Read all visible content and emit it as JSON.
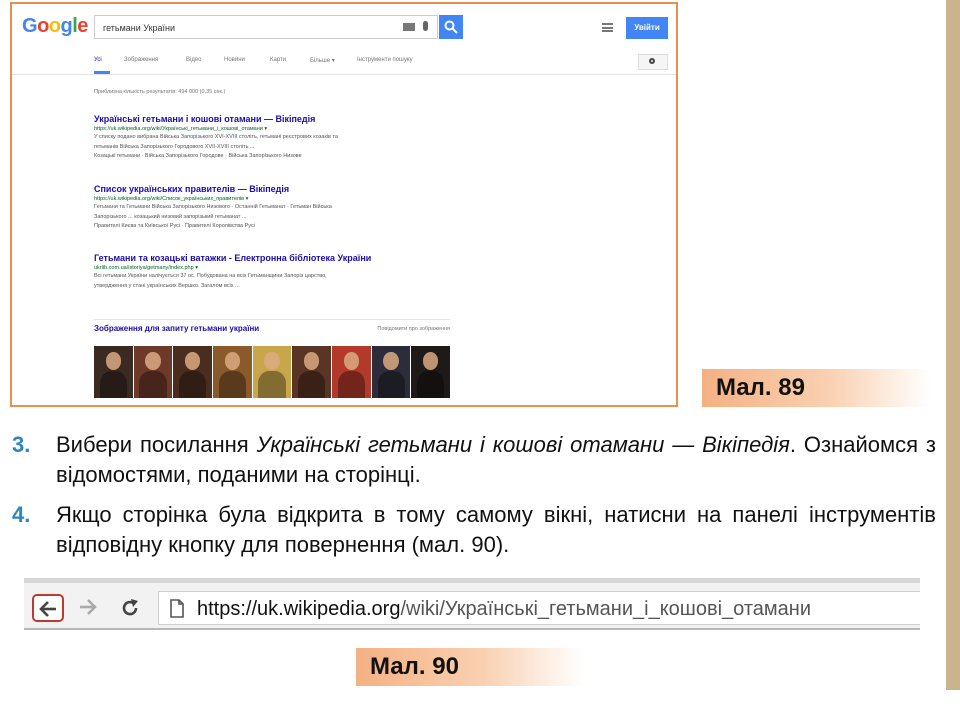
{
  "figure89": {
    "google": {
      "logo": [
        "G",
        "o",
        "o",
        "g",
        "l",
        "e"
      ],
      "query": "гетьмани України",
      "signin_label": "Увійти",
      "tabs": [
        {
          "label": "Усі",
          "active": true
        },
        {
          "label": "Зображення",
          "active": false
        },
        {
          "label": "Відео",
          "active": false
        },
        {
          "label": "Новини",
          "active": false
        },
        {
          "label": "Карти",
          "active": false
        },
        {
          "label": "Більше ▾",
          "active": false
        },
        {
          "label": "Інструменти пошуку",
          "active": false
        }
      ],
      "stats": "Приблизна кількість результатів: 494 000 (0,35 сек.)",
      "results": [
        {
          "title": "Українські гетьмани і кошові отамани — Вікіпедія",
          "url": "https://uk.wikipedia.org/wiki/Українські_гетьмани_і_кошові_отамани ▾",
          "snippets": [
            "У списку подано вибрана Війська Запорізького XVI-XVIII століть, гетьмані реєстрових козаків та",
            "гетьманів Війська Запорізького Городового XVII-XVIII століть ...",
            "Козацькі гетьмани · Війська Запорізького Городове · Війська Запорізького Низове"
          ]
        },
        {
          "title": "Список українських правителів — Вікіпедія",
          "url": "https://uk.wikipedia.org/wiki/Список_українських_правителів ▾",
          "snippets": [
            "Гетьмани та Гетьмани Війська Запорізького Низового · Останній Гетьманат · Гетьман Війська",
            "Запорізького ... козацький низовий запорізький гетьманат ...",
            "Правителі Києва та Київської Русі · Правителі Королівства Русі"
          ]
        },
        {
          "title": "Гетьмани та козацькі ватажки - Електронна бібліотека України",
          "url": "ukrlib.com.ua/istoriya/getmany/index.php ▾",
          "snippets": [
            "Всі гетьмани України налічується 37 ос. Побудована на всіх Гетьманщини Запоріз царство,",
            "утвердження у стані українських Вершко. Загалом всіх ..."
          ]
        }
      ],
      "images_title": "Зображення для запиту гетьмани україни",
      "images_more": "Повідомити про зображення",
      "thumb_colors": [
        "#3b2a22",
        "#6d3a2a",
        "#4a2d1f",
        "#8a5a2b",
        "#c8a64c",
        "#5a3424",
        "#b33a2a",
        "#2c2c3a",
        "#1e1a18"
      ]
    },
    "caption": "Мал. 89"
  },
  "steps": [
    {
      "number": "3.",
      "parts": [
        {
          "text": "Вибери посилання ",
          "italic": false
        },
        {
          "text": "Українські гетьмани і кошові отамани — Вікіпедія",
          "italic": true
        },
        {
          "text": ". Ознайомся з відомостями, поданими на сторінці.",
          "italic": false
        }
      ]
    },
    {
      "number": "4.",
      "parts": [
        {
          "text": "Якщо сторінка була відкрита в тому самому вікні, натисни на панелі інструментів відповідну кнопку для повернення (мал. 90).",
          "italic": false
        }
      ]
    }
  ],
  "figure90": {
    "url_host": "https://uk.wikipedia.org",
    "url_path": "/wiki/Українські_гетьмани_і_кошові_отамани",
    "caption": "Мал. 90",
    "icons": {
      "back": "arrow-left-icon",
      "forward": "arrow-right-icon",
      "reload": "reload-icon",
      "page": "page-icon"
    },
    "highlight_color": "#c0392b"
  },
  "colors": {
    "step_number": "#2e86c1",
    "figure_border": "#e8904f",
    "caption_bg": "#f4b183"
  }
}
